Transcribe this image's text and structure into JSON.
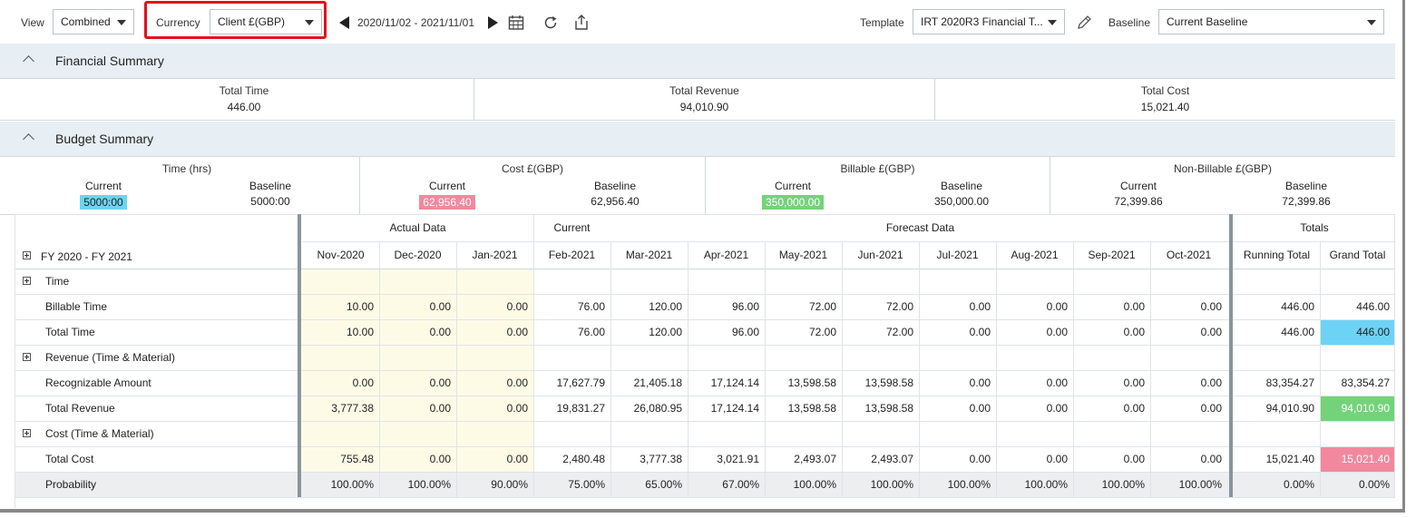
{
  "toolbar": {
    "view_label": "View",
    "view_value": "Combined",
    "currency_label": "Currency",
    "currency_value": "Client £(GBP)",
    "date_range": "2020/11/02 - 2021/11/01",
    "template_label": "Template",
    "template_value": "IRT 2020R3 Financial T...",
    "baseline_label": "Baseline",
    "baseline_value": "Current Baseline",
    "icons": [
      "prev-triangle-icon",
      "next-triangle-icon",
      "calendar-icon",
      "refresh-icon",
      "share-icon",
      "pencil-icon"
    ]
  },
  "financial_summary": {
    "title": "Financial Summary",
    "items": [
      {
        "label": "Total Time",
        "value": "446.00"
      },
      {
        "label": "Total Revenue",
        "value": "94,010.90"
      },
      {
        "label": "Total Cost",
        "value": "15,021.40"
      }
    ]
  },
  "budget_summary": {
    "title": "Budget Summary",
    "groups": [
      {
        "title": "Time (hrs)",
        "current_label": "Current",
        "current": "5000:00",
        "baseline_label": "Baseline",
        "baseline": "5000:00",
        "color": "#6dd3f5"
      },
      {
        "title": "Cost £(GBP)",
        "current_label": "Current",
        "current": "62,956.40",
        "baseline_label": "Baseline",
        "baseline": "62,956.40",
        "color": "#f2889e"
      },
      {
        "title": "Billable £(GBP)",
        "current_label": "Current",
        "current": "350,000.00",
        "baseline_label": "Baseline",
        "baseline": "350,000.00",
        "color": "#74d37a"
      },
      {
        "title": "Non-Billable £(GBP)",
        "current_label": "Current",
        "current": "72,399.86",
        "baseline_label": "Baseline",
        "baseline": "72,399.86",
        "color": ""
      }
    ]
  },
  "grid": {
    "group_headers": {
      "actual": "Actual Data",
      "current": "Current",
      "forecast": "Forecast Data",
      "totals": "Totals"
    },
    "period_label": "FY 2020 - FY 2021",
    "months": [
      "Nov-2020",
      "Dec-2020",
      "Jan-2021",
      "Feb-2021",
      "Mar-2021",
      "Apr-2021",
      "May-2021",
      "Jun-2021",
      "Jul-2021",
      "Aug-2021",
      "Sep-2021",
      "Oct-2021"
    ],
    "total_headers": [
      "Running Total",
      "Grand Total"
    ],
    "rows": [
      {
        "label": "Time",
        "expander": true,
        "values": [],
        "totals": []
      },
      {
        "label": "Billable Time",
        "values": [
          "10.00",
          "0.00",
          "0.00",
          "76.00",
          "120.00",
          "96.00",
          "72.00",
          "72.00",
          "0.00",
          "0.00",
          "0.00",
          "0.00"
        ],
        "totals": [
          "446.00",
          "446.00"
        ]
      },
      {
        "label": "Total Time",
        "values": [
          "10.00",
          "0.00",
          "0.00",
          "76.00",
          "120.00",
          "96.00",
          "72.00",
          "72.00",
          "0.00",
          "0.00",
          "0.00",
          "0.00"
        ],
        "totals": [
          "446.00",
          "446.00"
        ],
        "grand_color": "#6dd3f5"
      },
      {
        "label": "Revenue (Time & Material)",
        "expander": true,
        "values": [],
        "totals": []
      },
      {
        "label": "Recognizable Amount",
        "values": [
          "0.00",
          "0.00",
          "0.00",
          "17,627.79",
          "21,405.18",
          "17,124.14",
          "13,598.58",
          "13,598.58",
          "0.00",
          "0.00",
          "0.00",
          "0.00"
        ],
        "totals": [
          "83,354.27",
          "83,354.27"
        ]
      },
      {
        "label": "Total Revenue",
        "values": [
          "3,777.38",
          "0.00",
          "0.00",
          "19,831.27",
          "26,080.95",
          "17,124.14",
          "13,598.58",
          "13,598.58",
          "0.00",
          "0.00",
          "0.00",
          "0.00"
        ],
        "totals": [
          "94,010.90",
          "94,010.90"
        ],
        "grand_color": "#74d37a"
      },
      {
        "label": "Cost (Time & Material)",
        "expander": true,
        "values": [],
        "totals": []
      },
      {
        "label": "Total Cost",
        "values": [
          "755.48",
          "0.00",
          "0.00",
          "2,480.48",
          "3,777.38",
          "3,021.91",
          "2,493.07",
          "2,493.07",
          "0.00",
          "0.00",
          "0.00",
          "0.00"
        ],
        "totals": [
          "15,021.40",
          "15,021.40"
        ],
        "grand_color": "#f2889e"
      },
      {
        "label": "Probability",
        "values": [
          "100.00%",
          "100.00%",
          "90.00%",
          "75.00%",
          "65.00%",
          "67.00%",
          "100.00%",
          "100.00%",
          "100.00%",
          "100.00%",
          "100.00%",
          "100.00%"
        ],
        "totals": [
          "0.00%",
          "0.00%"
        ],
        "shaded": true
      }
    ]
  }
}
